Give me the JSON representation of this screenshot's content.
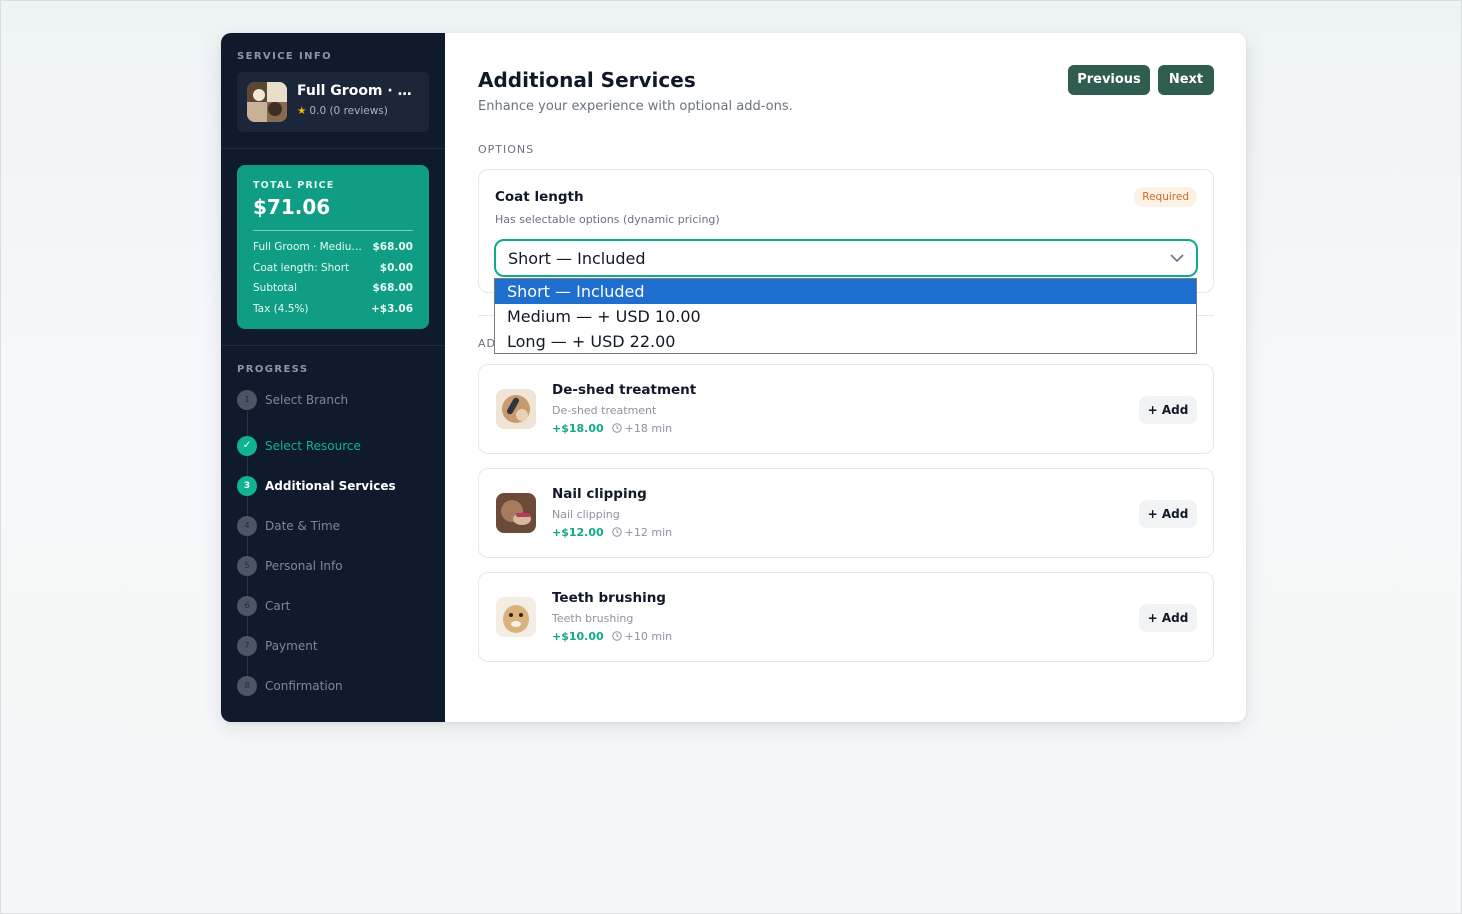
{
  "sidebar": {
    "service_info_label": "SERVICE INFO",
    "service": {
      "name": "Full Groom · Me...",
      "rating": "0.0 (0 reviews)"
    },
    "price": {
      "label": "TOTAL PRICE",
      "total": "$71.06",
      "lines": [
        {
          "label": "Full Groom · Medium ...",
          "value": "$68.00"
        },
        {
          "label": "Coat length: Short",
          "value": "$0.00"
        },
        {
          "label": "Subtotal",
          "value": "$68.00"
        },
        {
          "label": "Tax (4.5%)",
          "value": "+$3.06"
        }
      ]
    },
    "progress_label": "PROGRESS",
    "steps": [
      {
        "num": "1",
        "label": "Select Branch",
        "state": "pending"
      },
      {
        "num": "✓",
        "label": "Select Resource",
        "state": "done"
      },
      {
        "num": "3",
        "label": "Additional Services",
        "state": "active"
      },
      {
        "num": "4",
        "label": "Date & Time",
        "state": "pending"
      },
      {
        "num": "5",
        "label": "Personal Info",
        "state": "pending"
      },
      {
        "num": "6",
        "label": "Cart",
        "state": "pending"
      },
      {
        "num": "7",
        "label": "Payment",
        "state": "pending"
      },
      {
        "num": "8",
        "label": "Confirmation",
        "state": "pending"
      }
    ]
  },
  "main": {
    "title": "Additional Services",
    "subtitle": "Enhance your experience with optional add-ons.",
    "previous_label": "Previous",
    "next_label": "Next",
    "options_label": "OPTIONS",
    "option": {
      "name": "Coat length",
      "description": "Has selectable options (dynamic pricing)",
      "badge": "Required",
      "selected": "Short — Included",
      "choices": [
        "Short — Included",
        "Medium — + USD 10.00",
        "Long — + USD 22.00"
      ]
    },
    "addons_label": "AD",
    "addons": [
      {
        "name": "De-shed treatment",
        "description": "De-shed treatment",
        "price": "+$18.00",
        "duration": "+18 min",
        "button": "+ Add"
      },
      {
        "name": "Nail clipping",
        "description": "Nail clipping",
        "price": "+$12.00",
        "duration": "+12 min",
        "button": "+ Add"
      },
      {
        "name": "Teeth brushing",
        "description": "Teeth brushing",
        "price": "+$10.00",
        "duration": "+10 min",
        "button": "+ Add"
      }
    ]
  },
  "colors": {
    "sidebar_bg": "#0f1b2d",
    "accent": "#10a98a",
    "price_card": "#0f9e85",
    "nav_button": "#2f5d4f",
    "dropdown_highlight": "#1f6fd1",
    "required_badge": "#c2702a"
  },
  "icons": [
    "star-icon",
    "check-icon",
    "chevron-down-icon",
    "clock-icon"
  ]
}
